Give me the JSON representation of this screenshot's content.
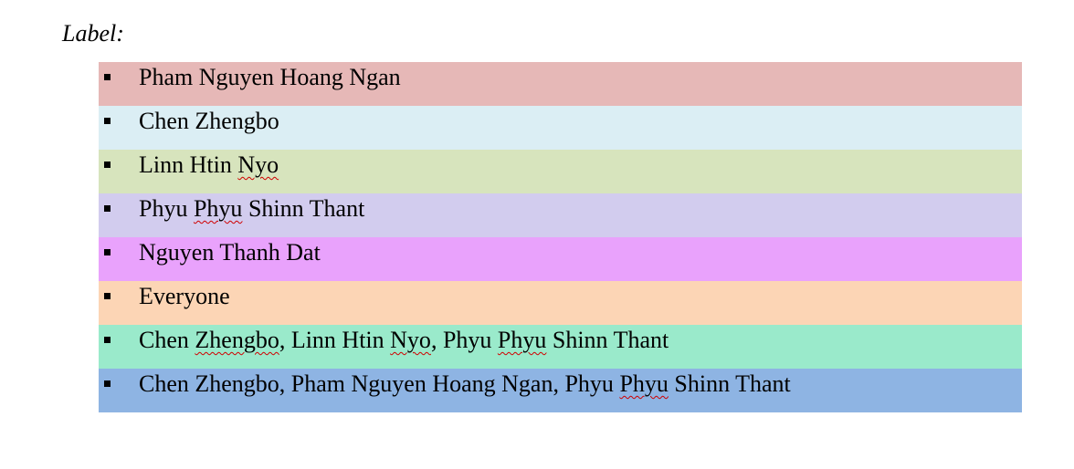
{
  "heading": "Label:",
  "items": [
    {
      "color": "#e6b8b7",
      "parts": [
        {
          "text": "Pham Nguyen Hoang Ngan",
          "misspelled": false
        }
      ]
    },
    {
      "color": "#dbeef4",
      "parts": [
        {
          "text": "Chen Zhengbo",
          "misspelled": false
        }
      ]
    },
    {
      "color": "#d7e4bd",
      "parts": [
        {
          "text": "Linn Htin ",
          "misspelled": false
        },
        {
          "text": "Nyo",
          "misspelled": true
        }
      ]
    },
    {
      "color": "#d2ccee",
      "parts": [
        {
          "text": "Phyu ",
          "misspelled": false
        },
        {
          "text": "Phyu",
          "misspelled": true
        },
        {
          "text": " Shinn Thant",
          "misspelled": false
        }
      ]
    },
    {
      "color": "#e9a2fc",
      "parts": [
        {
          "text": "Nguyen Thanh Dat",
          "misspelled": false
        }
      ]
    },
    {
      "color": "#fcd5b5",
      "parts": [
        {
          "text": "Everyone",
          "misspelled": false
        }
      ]
    },
    {
      "color": "#9aeacb",
      "parts": [
        {
          "text": "Chen ",
          "misspelled": false
        },
        {
          "text": "Zhengbo",
          "misspelled": true
        },
        {
          "text": ", Linn Htin ",
          "misspelled": false
        },
        {
          "text": "Nyo",
          "misspelled": true
        },
        {
          "text": ", Phyu ",
          "misspelled": false
        },
        {
          "text": "Phyu",
          "misspelled": true
        },
        {
          "text": " Shinn Thant",
          "misspelled": false
        }
      ]
    },
    {
      "color": "#8eb4e3",
      "parts": [
        {
          "text": "Chen Zhengbo, Pham Nguyen Hoang Ngan, Phyu ",
          "misspelled": false
        },
        {
          "text": "Phyu",
          "misspelled": true
        },
        {
          "text": " Shinn Thant",
          "misspelled": false
        }
      ]
    }
  ]
}
